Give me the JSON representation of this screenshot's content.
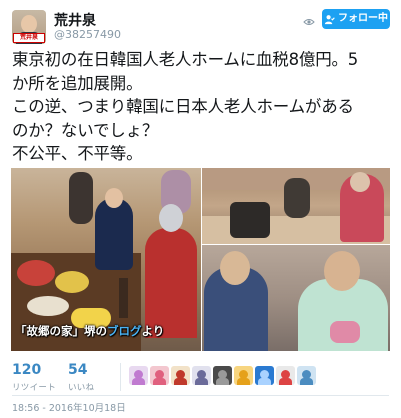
{
  "user": {
    "display_name": "荒井泉",
    "handle": "@38257490",
    "avatar_tag": "荒井泉"
  },
  "follow_button": {
    "label": "フォロー中"
  },
  "tweet": {
    "lines": [
      "東京初の在日韓国人老人ホームに血税8億円。5",
      "か所を追加展開。",
      "この逆、つまり韓国に日本人老人ホームがある",
      "のか？ないでしょ？",
      "不公平、不平等。"
    ]
  },
  "photo": {
    "caption_prefix": "「故郷の家」堺の",
    "caption_link": "ブログ",
    "caption_suffix": "より"
  },
  "stats": {
    "retweets": {
      "count": "120",
      "label": "リツイート"
    },
    "likes": {
      "count": "54",
      "label": "いいね"
    }
  },
  "likers": [
    {
      "icon": "avatar-1",
      "bg": "#e8d9f0",
      "fg": "#c07ad0"
    },
    {
      "icon": "avatar-2",
      "bg": "#f3c7cf",
      "fg": "#e0607e"
    },
    {
      "icon": "avatar-3",
      "bg": "#f2e2c8",
      "fg": "#c0392b"
    },
    {
      "icon": "avatar-4",
      "bg": "#e1e1ee",
      "fg": "#6b6b9a"
    },
    {
      "icon": "avatar-5",
      "bg": "#4a4a4a",
      "fg": "#9a9a9a"
    },
    {
      "icon": "avatar-6",
      "bg": "#f7d580",
      "fg": "#e5a11b"
    },
    {
      "icon": "avatar-7",
      "bg": "#2a7ad1",
      "fg": "#a9d2ff"
    },
    {
      "icon": "avatar-8",
      "bg": "#e9e9e9",
      "fg": "#d44"
    },
    {
      "icon": "avatar-9",
      "bg": "#cfe3f2",
      "fg": "#4b8cc0"
    }
  ],
  "timestamp": "18:56 - 2016年10月18日",
  "colors": {
    "accent": "#1da1f2",
    "stat": "#3b88c3",
    "muted": "#8899a6"
  }
}
